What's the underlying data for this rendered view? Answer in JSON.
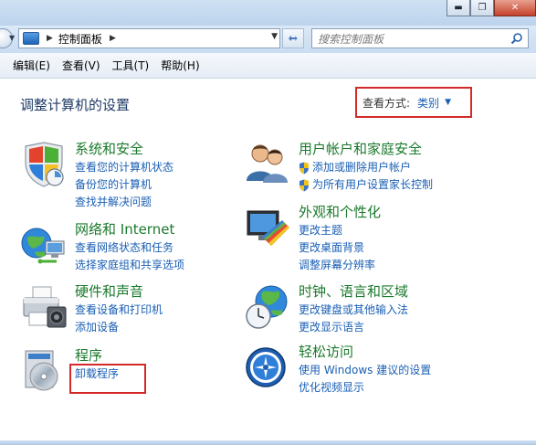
{
  "window": {
    "min_icon": "minimize-icon",
    "max_icon": "maximize-icon",
    "close_icon": "close-icon"
  },
  "address": {
    "path": "控制面板",
    "search_placeholder": "搜索控制面板"
  },
  "menu": [
    "编辑(E)",
    "查看(V)",
    "工具(T)",
    "帮助(H)"
  ],
  "heading": "调整计算机的设置",
  "view_by": {
    "label": "查看方式:",
    "value": "类别"
  },
  "categories": [
    {
      "title": "系统和安全",
      "links": [
        "查看您的计算机状态",
        "备份您的计算机",
        "查找并解决问题"
      ],
      "icon": "shield-flag-icon"
    },
    {
      "title": "网络和 Internet",
      "links": [
        "查看网络状态和任务",
        "选择家庭组和共享选项"
      ],
      "icon": "network-globe-icon"
    },
    {
      "title": "硬件和声音",
      "links": [
        "查看设备和打印机",
        "添加设备"
      ],
      "icon": "printer-icon"
    },
    {
      "title": "程序",
      "links": [
        "卸载程序"
      ],
      "icon": "programs-cd-icon"
    },
    {
      "title": "用户帐户和家庭安全",
      "links": [
        "添加或删除用户帐户",
        "为所有用户设置家长控制"
      ],
      "icon": "users-icon"
    },
    {
      "title": "外观和个性化",
      "links": [
        "更改主题",
        "更改桌面背景",
        "调整屏幕分辨率"
      ],
      "icon": "monitor-palette-icon"
    },
    {
      "title": "时钟、语言和区域",
      "links": [
        "更改键盘或其他输入法",
        "更改显示语言"
      ],
      "icon": "clock-globe-icon"
    },
    {
      "title": "轻松访问",
      "links": [
        "使用 Windows 建议的设置",
        "优化视频显示"
      ],
      "icon": "ease-of-access-icon"
    }
  ],
  "colors": {
    "category_title": "#1a7a2c",
    "link": "#1a5fb4",
    "highlight_box": "#d42a2a"
  }
}
